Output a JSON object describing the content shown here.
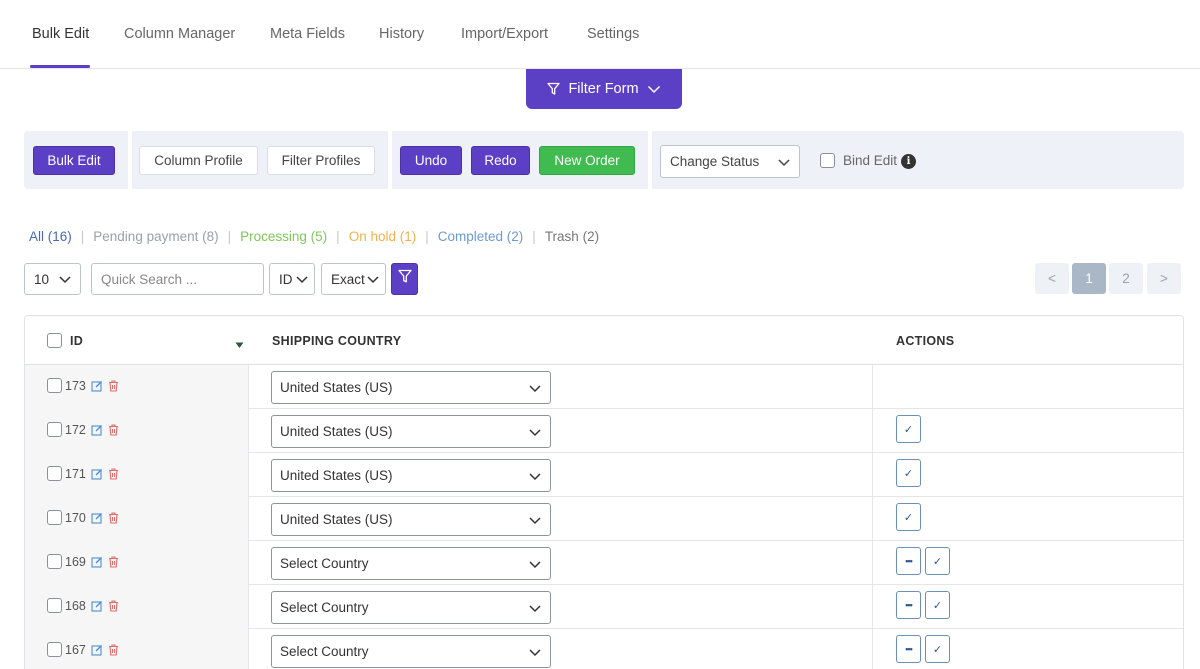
{
  "tabs": [
    {
      "label": "Bulk Edit",
      "active": true
    },
    {
      "label": "Column Manager",
      "active": false
    },
    {
      "label": "Meta Fields",
      "active": false
    },
    {
      "label": "History",
      "active": false
    },
    {
      "label": "Import/Export",
      "active": false
    },
    {
      "label": "Settings",
      "active": false
    }
  ],
  "filter_form": {
    "label": "Filter Form"
  },
  "toolbar": {
    "bulk_edit": "Bulk Edit",
    "column_profile": "Column Profile",
    "filter_profiles": "Filter Profiles",
    "undo": "Undo",
    "redo": "Redo",
    "new_order": "New Order",
    "change_status": "Change Status",
    "bind_edit": "Bind Edit"
  },
  "statuses": [
    {
      "label": "All (16)"
    },
    {
      "label": "Pending payment (8)"
    },
    {
      "label": "Processing (5)"
    },
    {
      "label": "On hold (1)"
    },
    {
      "label": "Completed (2)"
    },
    {
      "label": "Trash (2)"
    }
  ],
  "search": {
    "per_page": "10",
    "placeholder": "Quick Search ...",
    "field": "ID",
    "match": "Exact"
  },
  "pagination": {
    "prev": "<",
    "pages": [
      "1",
      "2"
    ],
    "current": "1",
    "next": ">"
  },
  "table": {
    "headers": {
      "id": "ID",
      "shipping_country": "SHIPPING COUNTRY",
      "actions": "ACTIONS"
    },
    "rows": [
      {
        "id": "173",
        "country": "United States (US)",
        "actions": []
      },
      {
        "id": "172",
        "country": "United States (US)",
        "actions": [
          "check"
        ]
      },
      {
        "id": "171",
        "country": "United States (US)",
        "actions": [
          "check"
        ]
      },
      {
        "id": "170",
        "country": "United States (US)",
        "actions": [
          "check"
        ]
      },
      {
        "id": "169",
        "country": "Select Country",
        "actions": [
          "more",
          "check"
        ]
      },
      {
        "id": "168",
        "country": "Select Country",
        "actions": [
          "more",
          "check"
        ]
      },
      {
        "id": "167",
        "country": "Select Country",
        "actions": [
          "more",
          "check"
        ]
      }
    ]
  },
  "colors": {
    "accent": "#5b3fc4",
    "success": "#3fbb4f",
    "action_border": "#6b8fb8"
  },
  "icons": {
    "filter": "filter-funnel-icon",
    "chevron": "chevron-down-icon",
    "edit": "edit-icon",
    "delete": "trash-icon",
    "info": "info-icon",
    "check": "check-icon",
    "more": "more-dots-icon"
  }
}
